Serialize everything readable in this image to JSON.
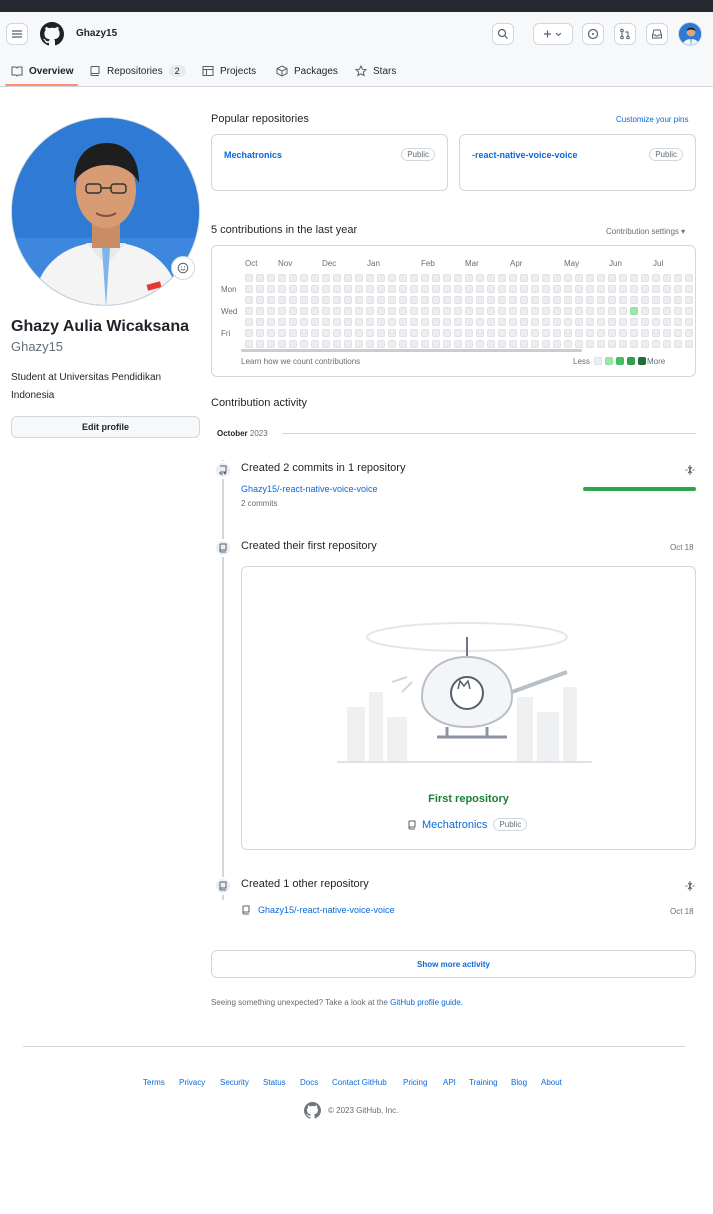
{
  "header": {
    "username": "Ghazy15"
  },
  "nav": {
    "tabs": [
      {
        "label": "Overview"
      },
      {
        "label": "Repositories",
        "count": "2"
      },
      {
        "label": "Projects"
      },
      {
        "label": "Packages"
      },
      {
        "label": "Stars"
      }
    ]
  },
  "profile": {
    "full_name": "Ghazy Aulia Wicaksana",
    "login": "Ghazy15",
    "bio": "Student at Universitas Pendidikan Indonesia",
    "edit_label": "Edit profile"
  },
  "pinned": {
    "title": "Popular repositories",
    "customize": "Customize your pins",
    "repos": [
      {
        "name": "Mechatronics",
        "visibility": "Public"
      },
      {
        "name": "-react-native-voice-voice",
        "visibility": "Public"
      }
    ]
  },
  "contributions": {
    "heading": "5 contributions in the last year",
    "settings": "Contribution settings",
    "months": [
      "Oct",
      "Nov",
      "Dec",
      "Jan",
      "Feb",
      "Mar",
      "Apr",
      "May",
      "Jun",
      "Jul"
    ],
    "days": [
      "Mon",
      "Wed",
      "Fri"
    ],
    "learn": "Learn how we count contributions",
    "less": "Less",
    "more": "More"
  },
  "activity": {
    "title": "Contribution activity",
    "month": "October",
    "year": "2023",
    "items": [
      {
        "title": "Created 2 commits in 1 repository",
        "repo": "Ghazy15/-react-native-voice-voice",
        "detail": "2 commits"
      },
      {
        "title": "Created their first repository",
        "date": "Oct 18",
        "card_title": "First repository",
        "repo": "Mechatronics",
        "visibility": "Public"
      },
      {
        "title": "Created 1 other repository",
        "repo": "Ghazy15/-react-native-voice-voice",
        "date": "Oct 18"
      }
    ],
    "show_more": "Show more activity",
    "unexpected": "Seeing something unexpected? Take a look at the",
    "guide": "GitHub profile guide."
  },
  "footer": {
    "links": [
      "Terms",
      "Privacy",
      "Security",
      "Status",
      "Docs",
      "Contact GitHub",
      "Pricing",
      "API",
      "Training",
      "Blog",
      "About"
    ],
    "copyright": "© 2023 GitHub, Inc."
  },
  "colors": {
    "accent": "#0969da",
    "green": "#2da44e",
    "light_green": "#9be9a8"
  }
}
